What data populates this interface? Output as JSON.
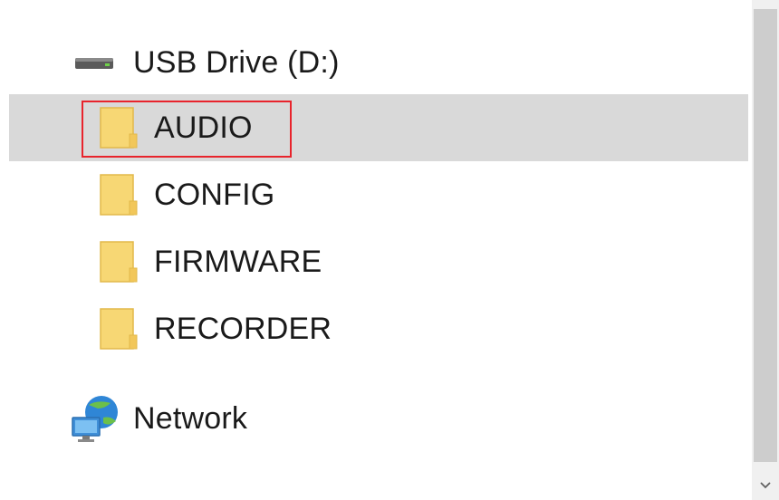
{
  "tree": {
    "drive": {
      "label": "USB Drive (D:)",
      "icon": "usb-drive-icon"
    },
    "folders": [
      {
        "label": "AUDIO",
        "icon": "folder-icon",
        "selected": true,
        "highlighted": true
      },
      {
        "label": "CONFIG",
        "icon": "folder-icon",
        "selected": false
      },
      {
        "label": "FIRMWARE",
        "icon": "folder-icon",
        "selected": false
      },
      {
        "label": "RECORDER",
        "icon": "folder-icon",
        "selected": false
      }
    ],
    "network": {
      "label": "Network",
      "icon": "network-icon"
    }
  },
  "scrollbar": {
    "down_arrow_icon": "chevron-down-icon"
  },
  "colors": {
    "selection_bg": "#d9d9d9",
    "highlight_border": "#e8242c",
    "folder_fill": "#f7d774",
    "folder_edge": "#e2b84a"
  }
}
